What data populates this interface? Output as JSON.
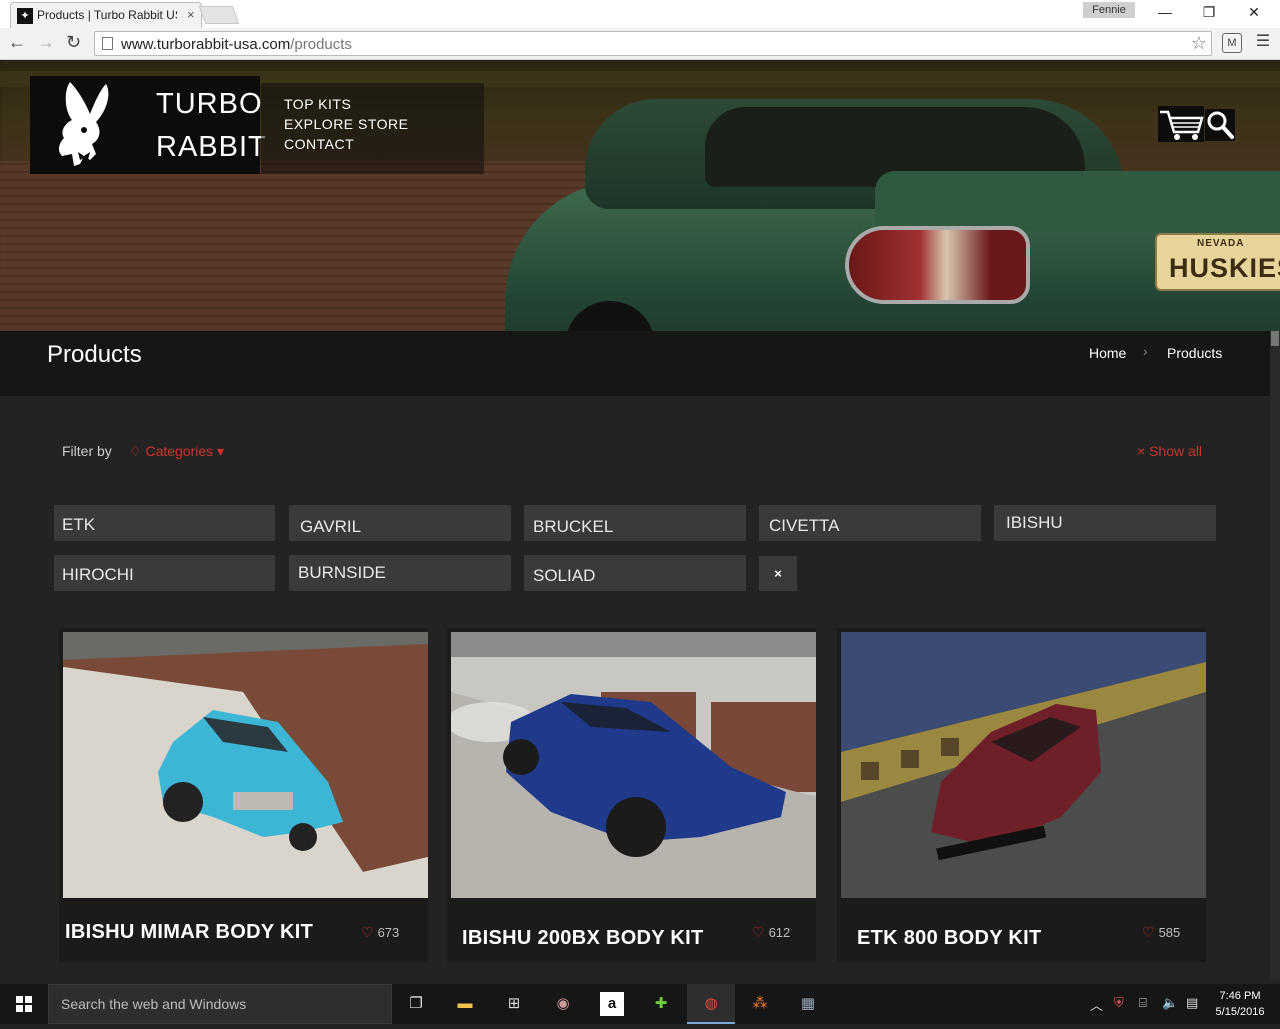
{
  "browser": {
    "tab_title": "Products | Turbo Rabbit US",
    "tab_favicon_icon": "playboy-bunny-icon",
    "profile_name": "Fennie",
    "url_domain": "www.turborabbit-usa.com",
    "url_path": "/products"
  },
  "header": {
    "logo_line1": "TURBO",
    "logo_line2": "RABBIT",
    "nav": [
      "TOP KITS",
      "EXPLORE STORE",
      "CONTACT"
    ],
    "plate_state": "NEVADA",
    "plate_text": "HUSKIES"
  },
  "page": {
    "title": "Products",
    "breadcrumb": [
      "Home",
      "Products"
    ]
  },
  "filter": {
    "label": "Filter by",
    "categories_label": "Categories",
    "show_all_label": "Show all",
    "chips": [
      "ETK",
      "GAVRIL",
      "BRUCKEL",
      "CIVETTA",
      "IBISHU",
      "HIROCHI",
      "BURNSIDE",
      "SOLIAD"
    ],
    "clear_label": "×"
  },
  "products": [
    {
      "title": "IBISHU MIMAR BODY KIT",
      "likes": "673",
      "car_color": "#3cb6d4"
    },
    {
      "title": "IBISHU 200BX BODY KIT",
      "likes": "612",
      "car_color": "#1f3a8a"
    },
    {
      "title": "ETK 800 BODY KIT",
      "likes": "585",
      "car_color": "#6e1f28"
    }
  ],
  "taskbar": {
    "search_placeholder": "Search the web and Windows",
    "time": "7:46 PM",
    "date": "5/15/2016"
  },
  "colors": {
    "accent": "#d32f2f",
    "page_bg": "#232323",
    "chip_bg": "#3a3a3a"
  }
}
